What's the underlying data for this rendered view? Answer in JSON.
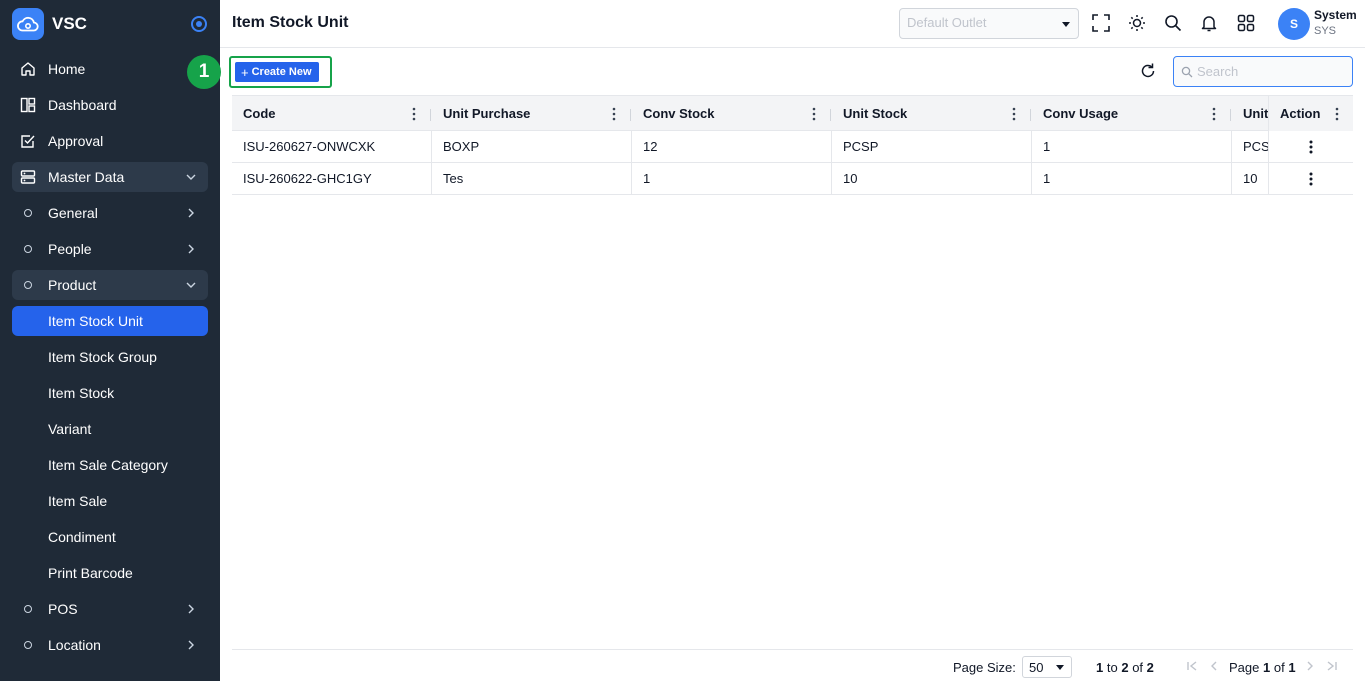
{
  "brand": {
    "name": "VSC"
  },
  "sidebar": {
    "items": [
      {
        "label": "Home"
      },
      {
        "label": "Dashboard"
      },
      {
        "label": "Approval"
      },
      {
        "label": "Master Data"
      },
      {
        "label": "General"
      },
      {
        "label": "People"
      },
      {
        "label": "Product"
      },
      {
        "label": "Item Stock Unit"
      },
      {
        "label": "Item Stock Group"
      },
      {
        "label": "Item Stock"
      },
      {
        "label": "Variant"
      },
      {
        "label": "Item Sale Category"
      },
      {
        "label": "Item Sale"
      },
      {
        "label": "Condiment"
      },
      {
        "label": "Print Barcode"
      },
      {
        "label": "POS"
      },
      {
        "label": "Location"
      }
    ]
  },
  "header": {
    "title": "Item Stock Unit",
    "outlet_placeholder": "Default Outlet",
    "user": {
      "initial": "S",
      "name": "System",
      "code": "SYS"
    }
  },
  "toolbar": {
    "step_badge": "1",
    "create_label": "Create New",
    "search_placeholder": "Search"
  },
  "table": {
    "columns": [
      "Code",
      "Unit Purchase",
      "Conv Stock",
      "Unit Stock",
      "Conv Usage",
      "Unit",
      "Action"
    ],
    "rows": [
      [
        "ISU-260627-ONWCXK",
        "BOXP",
        "12",
        "PCSP",
        "1",
        "PCS"
      ],
      [
        "ISU-260622-GHC1GY",
        "Tes",
        "1",
        "10",
        "1",
        "10"
      ]
    ]
  },
  "footer": {
    "page_size_label": "Page Size:",
    "page_size": "50",
    "range_from": "1",
    "range_to_word": "to",
    "range_to": "2",
    "of_word": "of",
    "range_total": "2",
    "page_word": "Page",
    "page_current": "1",
    "page_total": "1"
  },
  "colors": {
    "sidebar_bg": "#1f2a37",
    "accent": "#2563eb",
    "highlight": "#16a34a"
  }
}
